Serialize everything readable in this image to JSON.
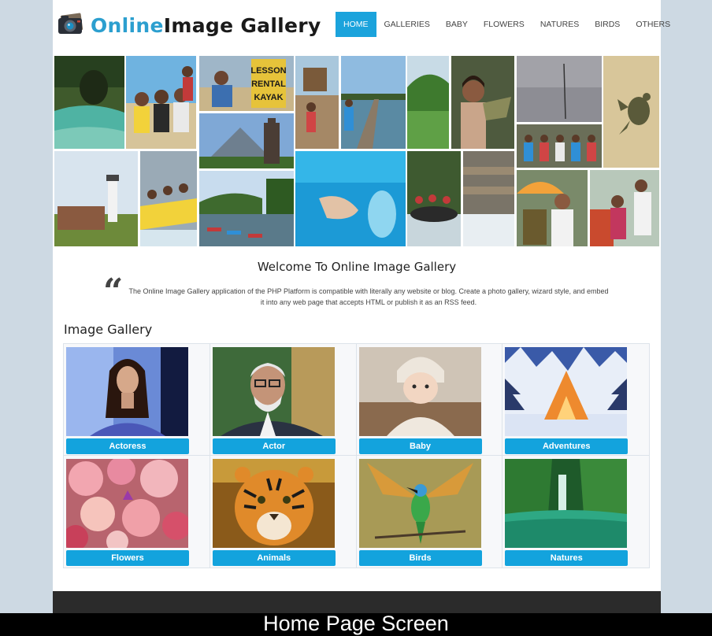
{
  "brand": {
    "part1": "Online",
    "part2": "Image Gallery"
  },
  "nav": [
    {
      "label": "HOME",
      "active": true
    },
    {
      "label": "GALLERIES",
      "active": false
    },
    {
      "label": "BABY",
      "active": false
    },
    {
      "label": "FLOWERS",
      "active": false
    },
    {
      "label": "NATURES",
      "active": false
    },
    {
      "label": "BIRDS",
      "active": false
    },
    {
      "label": "OTHERS",
      "active": false
    }
  ],
  "collage_signs": {
    "sign1": "LESSON",
    "sign2": "RENTAL",
    "sign3": "KAYAK"
  },
  "welcome": {
    "title": "Welcome To Online Image Gallery",
    "text": "The Online Image Gallery application of the PHP Platform is compatible with literally any website or blog. Create a photo gallery, wizard style, and embed it into any web page that accepts HTML or publish it as an RSS feed."
  },
  "gallery": {
    "heading": "Image Gallery",
    "categories": [
      "Actoress",
      "Actor",
      "Baby",
      "Adventures",
      "Flowers",
      "Animals",
      "Birds",
      "Natures"
    ]
  },
  "caption": "Home Page Screen",
  "colors": {
    "accent": "#1ba3dc",
    "brand_blue": "#2c9fcf",
    "footer": "#2b2b2b"
  }
}
